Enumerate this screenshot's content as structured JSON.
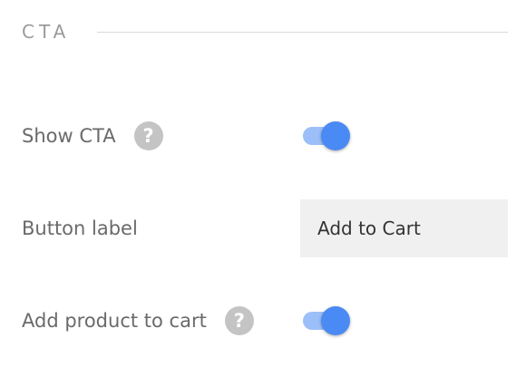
{
  "section": {
    "title": "CTA"
  },
  "rows": {
    "show_cta": {
      "label": "Show CTA",
      "help_icon": "question-icon",
      "help_glyph": "?",
      "toggle_on": true
    },
    "button_label": {
      "label": "Button label",
      "value": "Add to Cart"
    },
    "add_to_cart": {
      "label": "Add product to cart",
      "help_icon": "question-icon",
      "help_glyph": "?",
      "toggle_on": true
    }
  },
  "colors": {
    "toggle_thumb": "#4a8af4",
    "toggle_track": "#9cbff9",
    "help_icon_bg": "#c4c4c4",
    "input_bg": "#f0f0f0",
    "divider": "#d9d9d9"
  }
}
